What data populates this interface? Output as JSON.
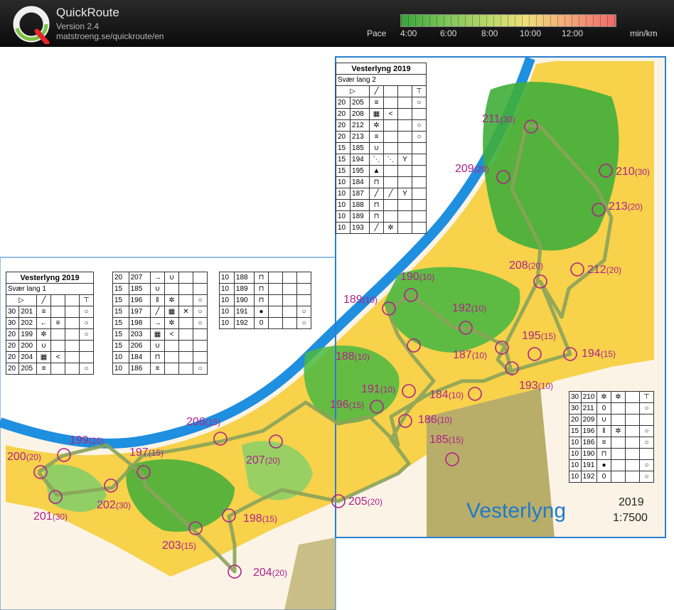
{
  "app": {
    "title": "QuickRoute",
    "version": "Version 2.4",
    "url": "matstroeng.se/quickroute/en"
  },
  "pace": {
    "label": "Pace",
    "ticks": [
      "4:00",
      "6:00",
      "8:00",
      "10:00",
      "12:00"
    ],
    "unit": "min/km"
  },
  "map": {
    "name": "Vesterlyng",
    "year": "2019",
    "scale": "1:7500"
  },
  "controls": [
    {
      "label": "211",
      "sub": "(30)"
    },
    {
      "label": "209",
      "sub": "(20)"
    },
    {
      "label": "210",
      "sub": "(30)"
    },
    {
      "label": "213",
      "sub": "(20)"
    },
    {
      "label": "212",
      "sub": "(20)"
    },
    {
      "label": "208",
      "sub": "(20)"
    },
    {
      "label": "190",
      "sub": "(10)"
    },
    {
      "label": "189",
      "sub": "(10)"
    },
    {
      "label": "192",
      "sub": "(10)"
    },
    {
      "label": "195",
      "sub": "(15)"
    },
    {
      "label": "194",
      "sub": "(15)"
    },
    {
      "label": "188",
      "sub": "(10)"
    },
    {
      "label": "187",
      "sub": "(10)"
    },
    {
      "label": "193",
      "sub": "(10)"
    },
    {
      "label": "191",
      "sub": "(10)"
    },
    {
      "label": "184",
      "sub": "(10)"
    },
    {
      "label": "196",
      "sub": "(15)"
    },
    {
      "label": "186",
      "sub": "(10)"
    },
    {
      "label": "185",
      "sub": "(15)"
    },
    {
      "label": "206",
      "sub": "(15)"
    },
    {
      "label": "207",
      "sub": "(20)"
    },
    {
      "label": "199",
      "sub": "(20)"
    },
    {
      "label": "197",
      "sub": "(15)"
    },
    {
      "label": "200",
      "sub": "(20)"
    },
    {
      "label": "202",
      "sub": "(30)"
    },
    {
      "label": "201",
      "sub": "(30)"
    },
    {
      "label": "205",
      "sub": "(20)"
    },
    {
      "label": "198",
      "sub": "(15)"
    },
    {
      "label": "203",
      "sub": "(15)"
    },
    {
      "label": "204",
      "sub": "(20)"
    }
  ],
  "description_tables": {
    "left": {
      "title": "Vesterlyng 2019",
      "course": "Svær lang 1",
      "rows": [
        [
          "30",
          "201"
        ],
        [
          "30",
          "202"
        ],
        [
          "20",
          "199"
        ],
        [
          "20",
          "200"
        ],
        [
          "20",
          "204"
        ],
        [
          "20",
          "205"
        ]
      ]
    },
    "middle": {
      "rows": [
        [
          "20",
          "207"
        ],
        [
          "15",
          "185"
        ],
        [
          "15",
          "196"
        ],
        [
          "15",
          "197"
        ],
        [
          "15",
          "198"
        ],
        [
          "15",
          "203"
        ],
        [
          "15",
          "206"
        ],
        [
          "10",
          "184"
        ],
        [
          "10",
          "186"
        ]
      ]
    },
    "right_small": {
      "rows": [
        [
          "10",
          "188"
        ],
        [
          "10",
          "189"
        ],
        [
          "10",
          "190"
        ],
        [
          "10",
          "191"
        ],
        [
          "10",
          "192"
        ]
      ]
    },
    "top": {
      "title": "Vesterlyng 2019",
      "course": "Svær lang 2",
      "rows": [
        [
          "20",
          "205"
        ],
        [
          "20",
          "208"
        ],
        [
          "20",
          "212"
        ],
        [
          "20",
          "213"
        ],
        [
          "15",
          "185"
        ],
        [
          "15",
          "194"
        ],
        [
          "15",
          "195"
        ],
        [
          "10",
          "184"
        ],
        [
          "10",
          "187"
        ],
        [
          "10",
          "188"
        ],
        [
          "10",
          "189"
        ],
        [
          "10",
          "193"
        ]
      ]
    },
    "bottom_right": {
      "rows": [
        [
          "30",
          "210"
        ],
        [
          "30",
          "211"
        ],
        [
          "20",
          "209"
        ],
        [
          "15",
          "196"
        ],
        [
          "10",
          "186"
        ],
        [
          "10",
          "190"
        ],
        [
          "10",
          "191"
        ],
        [
          "10",
          "192"
        ]
      ]
    }
  },
  "colors": {
    "sea": "#1f8fe0",
    "forest": "#3fae3a",
    "open": "#f7d24a",
    "route": "#8aa35a",
    "control": "#b0208a"
  }
}
